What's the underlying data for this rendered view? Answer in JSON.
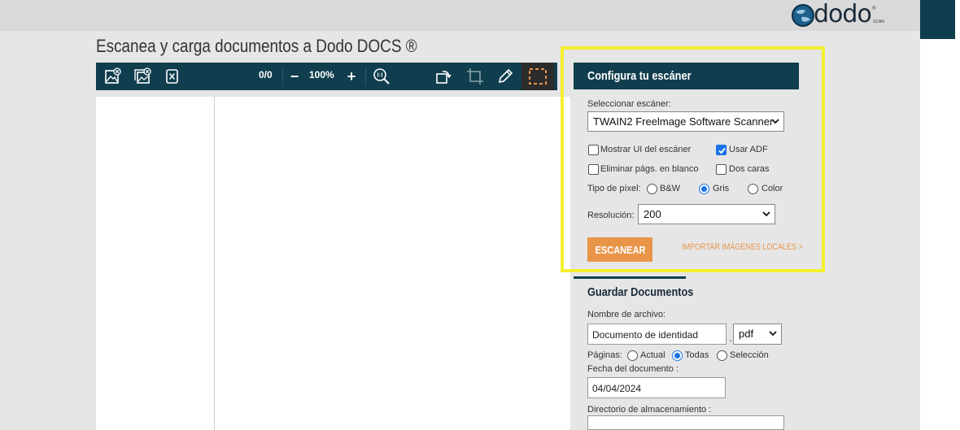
{
  "brand": {
    "name": "dodo",
    "sub": "SCAN",
    "reg": "®"
  },
  "page": {
    "title": "Escanea y carga documentos a Dodo DOCS ®"
  },
  "toolbar": {
    "page_counter": "0/0",
    "zoom": "100%",
    "zoom_out": "−",
    "zoom_in": "+"
  },
  "scanner": {
    "title": "Configura tu escáner",
    "select_label": "Seleccionar escáner:",
    "select_value": "TWAIN2 Freelmage Software Scanner",
    "show_ui": "Mostrar UI del escáner",
    "use_adf": "Usar ADF",
    "remove_blank": "Eliminar págs. en blanco",
    "duplex": "Dos caras",
    "pixel_type_label": "Tipo de píxel:",
    "pixel_bw": "B&W",
    "pixel_gray": "Gris",
    "pixel_color": "Color",
    "resolution_label": "Resolución:",
    "resolution_value": "200",
    "scan_button": "ESCANEAR",
    "import_link": "IMPORTAR IMÁGENES LOCALES >"
  },
  "save": {
    "title": "Guardar Documentos",
    "filename_label": "Nombre de archivo:",
    "filename_value": "Documento de identidad",
    "dot": ".",
    "format_value": "pdf",
    "pages_label": "Páginas:",
    "pages_actual": "Actual",
    "pages_all": "Todas",
    "pages_selection": "Selección",
    "date_label": "Fecha del documento :",
    "date_value": "04/04/2024",
    "dir_label": "Directorio de almacenamiento :"
  },
  "colors": {
    "accent": "#103e4e",
    "orange": "#e8954a",
    "highlight": "#f5ef2e",
    "check": "#1a73e8"
  }
}
